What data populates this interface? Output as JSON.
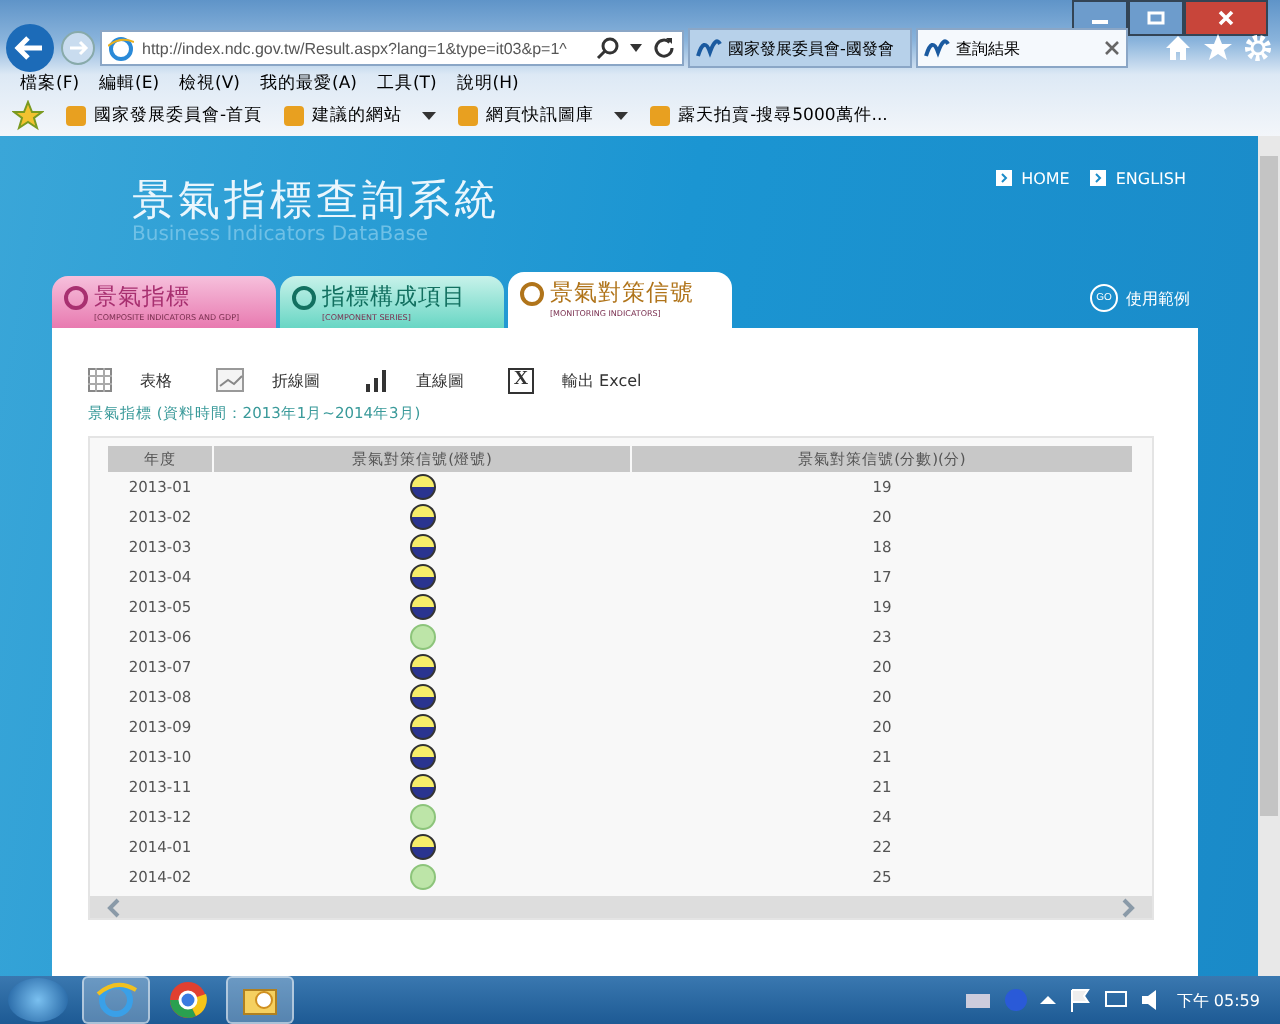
{
  "browser": {
    "address": "http://index.ndc.gov.tw/Result.aspx?lang=1&type=it03&p=1^",
    "tabs": [
      {
        "label": "國家發展委員會-國發會",
        "selected": false
      },
      {
        "label": "查詢結果",
        "selected": true
      }
    ],
    "menu": [
      "檔案(F)",
      "編輯(E)",
      "檢視(V)",
      "我的最愛(A)",
      "工具(T)",
      "說明(H)"
    ],
    "favorites": [
      {
        "label": "國家發展委員會-首頁",
        "dropdown": false
      },
      {
        "label": "建議的網站",
        "dropdown": true
      },
      {
        "label": "網頁快訊圖庫",
        "dropdown": true
      },
      {
        "label": "露天拍賣-搜尋5000萬件...",
        "dropdown": false
      }
    ]
  },
  "site": {
    "title": "景氣指標查詢系統",
    "subtitle": "Business Indicators DataBase",
    "links": [
      "HOME",
      "ENGLISH"
    ],
    "help": "使用範例",
    "help_badge": "GO"
  },
  "nav_tabs": [
    {
      "label": "景氣指標",
      "sub": "[COMPOSITE INDICATORS AND GDP]",
      "selected": false
    },
    {
      "label": "指標構成項目",
      "sub": "[COMPONENT SERIES]",
      "selected": false
    },
    {
      "label": "景氣對策信號",
      "sub": "[MONITORING INDICATORS]",
      "selected": true
    }
  ],
  "toolbar": [
    {
      "kind": "table",
      "label": "表格"
    },
    {
      "kind": "line",
      "label": "折線圖"
    },
    {
      "kind": "bar",
      "label": "直線圖"
    },
    {
      "kind": "excel",
      "label": "輸出 Excel",
      "glyph": "X"
    }
  ],
  "caption": "景氣指標 (資料時間：2013年1月~2014年3月)",
  "table": {
    "columns": [
      "年度",
      "景氣對策信號(燈號)",
      "景氣對策信號(分數)(分)"
    ],
    "rows": [
      {
        "period": "2013-01",
        "kind": "yellow-blue",
        "score": "19"
      },
      {
        "period": "2013-02",
        "kind": "yellow-blue",
        "score": "20"
      },
      {
        "period": "2013-03",
        "kind": "yellow-blue",
        "score": "18"
      },
      {
        "period": "2013-04",
        "kind": "yellow-blue",
        "score": "17"
      },
      {
        "period": "2013-05",
        "kind": "yellow-blue",
        "score": "19"
      },
      {
        "period": "2013-06",
        "kind": "green",
        "score": "23"
      },
      {
        "period": "2013-07",
        "kind": "yellow-blue",
        "score": "20"
      },
      {
        "period": "2013-08",
        "kind": "yellow-blue",
        "score": "20"
      },
      {
        "period": "2013-09",
        "kind": "yellow-blue",
        "score": "20"
      },
      {
        "period": "2013-10",
        "kind": "yellow-blue",
        "score": "21"
      },
      {
        "period": "2013-11",
        "kind": "yellow-blue",
        "score": "21"
      },
      {
        "period": "2013-12",
        "kind": "green",
        "score": "24"
      },
      {
        "period": "2014-01",
        "kind": "yellow-blue",
        "score": "22"
      },
      {
        "period": "2014-02",
        "kind": "green",
        "score": "25"
      }
    ]
  },
  "taskbar": {
    "clock": "下午 05:59"
  }
}
